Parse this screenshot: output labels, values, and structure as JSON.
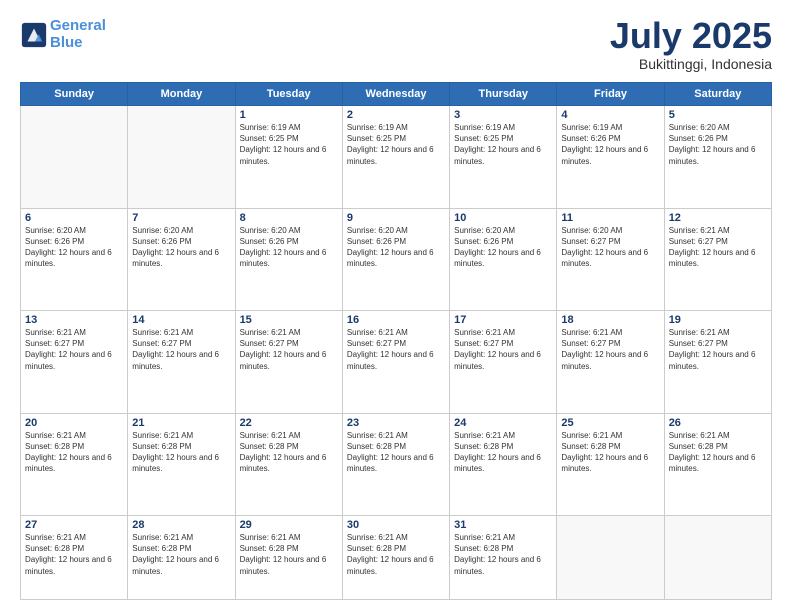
{
  "header": {
    "logo_line1": "General",
    "logo_line2": "Blue",
    "month": "July 2025",
    "location": "Bukittinggi, Indonesia"
  },
  "days_of_week": [
    "Sunday",
    "Monday",
    "Tuesday",
    "Wednesday",
    "Thursday",
    "Friday",
    "Saturday"
  ],
  "weeks": [
    [
      {
        "day": "",
        "empty": true
      },
      {
        "day": "",
        "empty": true
      },
      {
        "day": "1",
        "sunrise": "6:19 AM",
        "sunset": "6:25 PM",
        "daylight": "12 hours and 6 minutes."
      },
      {
        "day": "2",
        "sunrise": "6:19 AM",
        "sunset": "6:25 PM",
        "daylight": "12 hours and 6 minutes."
      },
      {
        "day": "3",
        "sunrise": "6:19 AM",
        "sunset": "6:25 PM",
        "daylight": "12 hours and 6 minutes."
      },
      {
        "day": "4",
        "sunrise": "6:19 AM",
        "sunset": "6:26 PM",
        "daylight": "12 hours and 6 minutes."
      },
      {
        "day": "5",
        "sunrise": "6:20 AM",
        "sunset": "6:26 PM",
        "daylight": "12 hours and 6 minutes."
      }
    ],
    [
      {
        "day": "6",
        "sunrise": "6:20 AM",
        "sunset": "6:26 PM",
        "daylight": "12 hours and 6 minutes."
      },
      {
        "day": "7",
        "sunrise": "6:20 AM",
        "sunset": "6:26 PM",
        "daylight": "12 hours and 6 minutes."
      },
      {
        "day": "8",
        "sunrise": "6:20 AM",
        "sunset": "6:26 PM",
        "daylight": "12 hours and 6 minutes."
      },
      {
        "day": "9",
        "sunrise": "6:20 AM",
        "sunset": "6:26 PM",
        "daylight": "12 hours and 6 minutes."
      },
      {
        "day": "10",
        "sunrise": "6:20 AM",
        "sunset": "6:26 PM",
        "daylight": "12 hours and 6 minutes."
      },
      {
        "day": "11",
        "sunrise": "6:20 AM",
        "sunset": "6:27 PM",
        "daylight": "12 hours and 6 minutes."
      },
      {
        "day": "12",
        "sunrise": "6:21 AM",
        "sunset": "6:27 PM",
        "daylight": "12 hours and 6 minutes."
      }
    ],
    [
      {
        "day": "13",
        "sunrise": "6:21 AM",
        "sunset": "6:27 PM",
        "daylight": "12 hours and 6 minutes."
      },
      {
        "day": "14",
        "sunrise": "6:21 AM",
        "sunset": "6:27 PM",
        "daylight": "12 hours and 6 minutes."
      },
      {
        "day": "15",
        "sunrise": "6:21 AM",
        "sunset": "6:27 PM",
        "daylight": "12 hours and 6 minutes."
      },
      {
        "day": "16",
        "sunrise": "6:21 AM",
        "sunset": "6:27 PM",
        "daylight": "12 hours and 6 minutes."
      },
      {
        "day": "17",
        "sunrise": "6:21 AM",
        "sunset": "6:27 PM",
        "daylight": "12 hours and 6 minutes."
      },
      {
        "day": "18",
        "sunrise": "6:21 AM",
        "sunset": "6:27 PM",
        "daylight": "12 hours and 6 minutes."
      },
      {
        "day": "19",
        "sunrise": "6:21 AM",
        "sunset": "6:27 PM",
        "daylight": "12 hours and 6 minutes."
      }
    ],
    [
      {
        "day": "20",
        "sunrise": "6:21 AM",
        "sunset": "6:28 PM",
        "daylight": "12 hours and 6 minutes."
      },
      {
        "day": "21",
        "sunrise": "6:21 AM",
        "sunset": "6:28 PM",
        "daylight": "12 hours and 6 minutes."
      },
      {
        "day": "22",
        "sunrise": "6:21 AM",
        "sunset": "6:28 PM",
        "daylight": "12 hours and 6 minutes."
      },
      {
        "day": "23",
        "sunrise": "6:21 AM",
        "sunset": "6:28 PM",
        "daylight": "12 hours and 6 minutes."
      },
      {
        "day": "24",
        "sunrise": "6:21 AM",
        "sunset": "6:28 PM",
        "daylight": "12 hours and 6 minutes."
      },
      {
        "day": "25",
        "sunrise": "6:21 AM",
        "sunset": "6:28 PM",
        "daylight": "12 hours and 6 minutes."
      },
      {
        "day": "26",
        "sunrise": "6:21 AM",
        "sunset": "6:28 PM",
        "daylight": "12 hours and 6 minutes."
      }
    ],
    [
      {
        "day": "27",
        "sunrise": "6:21 AM",
        "sunset": "6:28 PM",
        "daylight": "12 hours and 6 minutes."
      },
      {
        "day": "28",
        "sunrise": "6:21 AM",
        "sunset": "6:28 PM",
        "daylight": "12 hours and 6 minutes."
      },
      {
        "day": "29",
        "sunrise": "6:21 AM",
        "sunset": "6:28 PM",
        "daylight": "12 hours and 6 minutes."
      },
      {
        "day": "30",
        "sunrise": "6:21 AM",
        "sunset": "6:28 PM",
        "daylight": "12 hours and 6 minutes."
      },
      {
        "day": "31",
        "sunrise": "6:21 AM",
        "sunset": "6:28 PM",
        "daylight": "12 hours and 6 minutes."
      },
      {
        "day": "",
        "empty": true
      },
      {
        "day": "",
        "empty": true
      }
    ]
  ]
}
